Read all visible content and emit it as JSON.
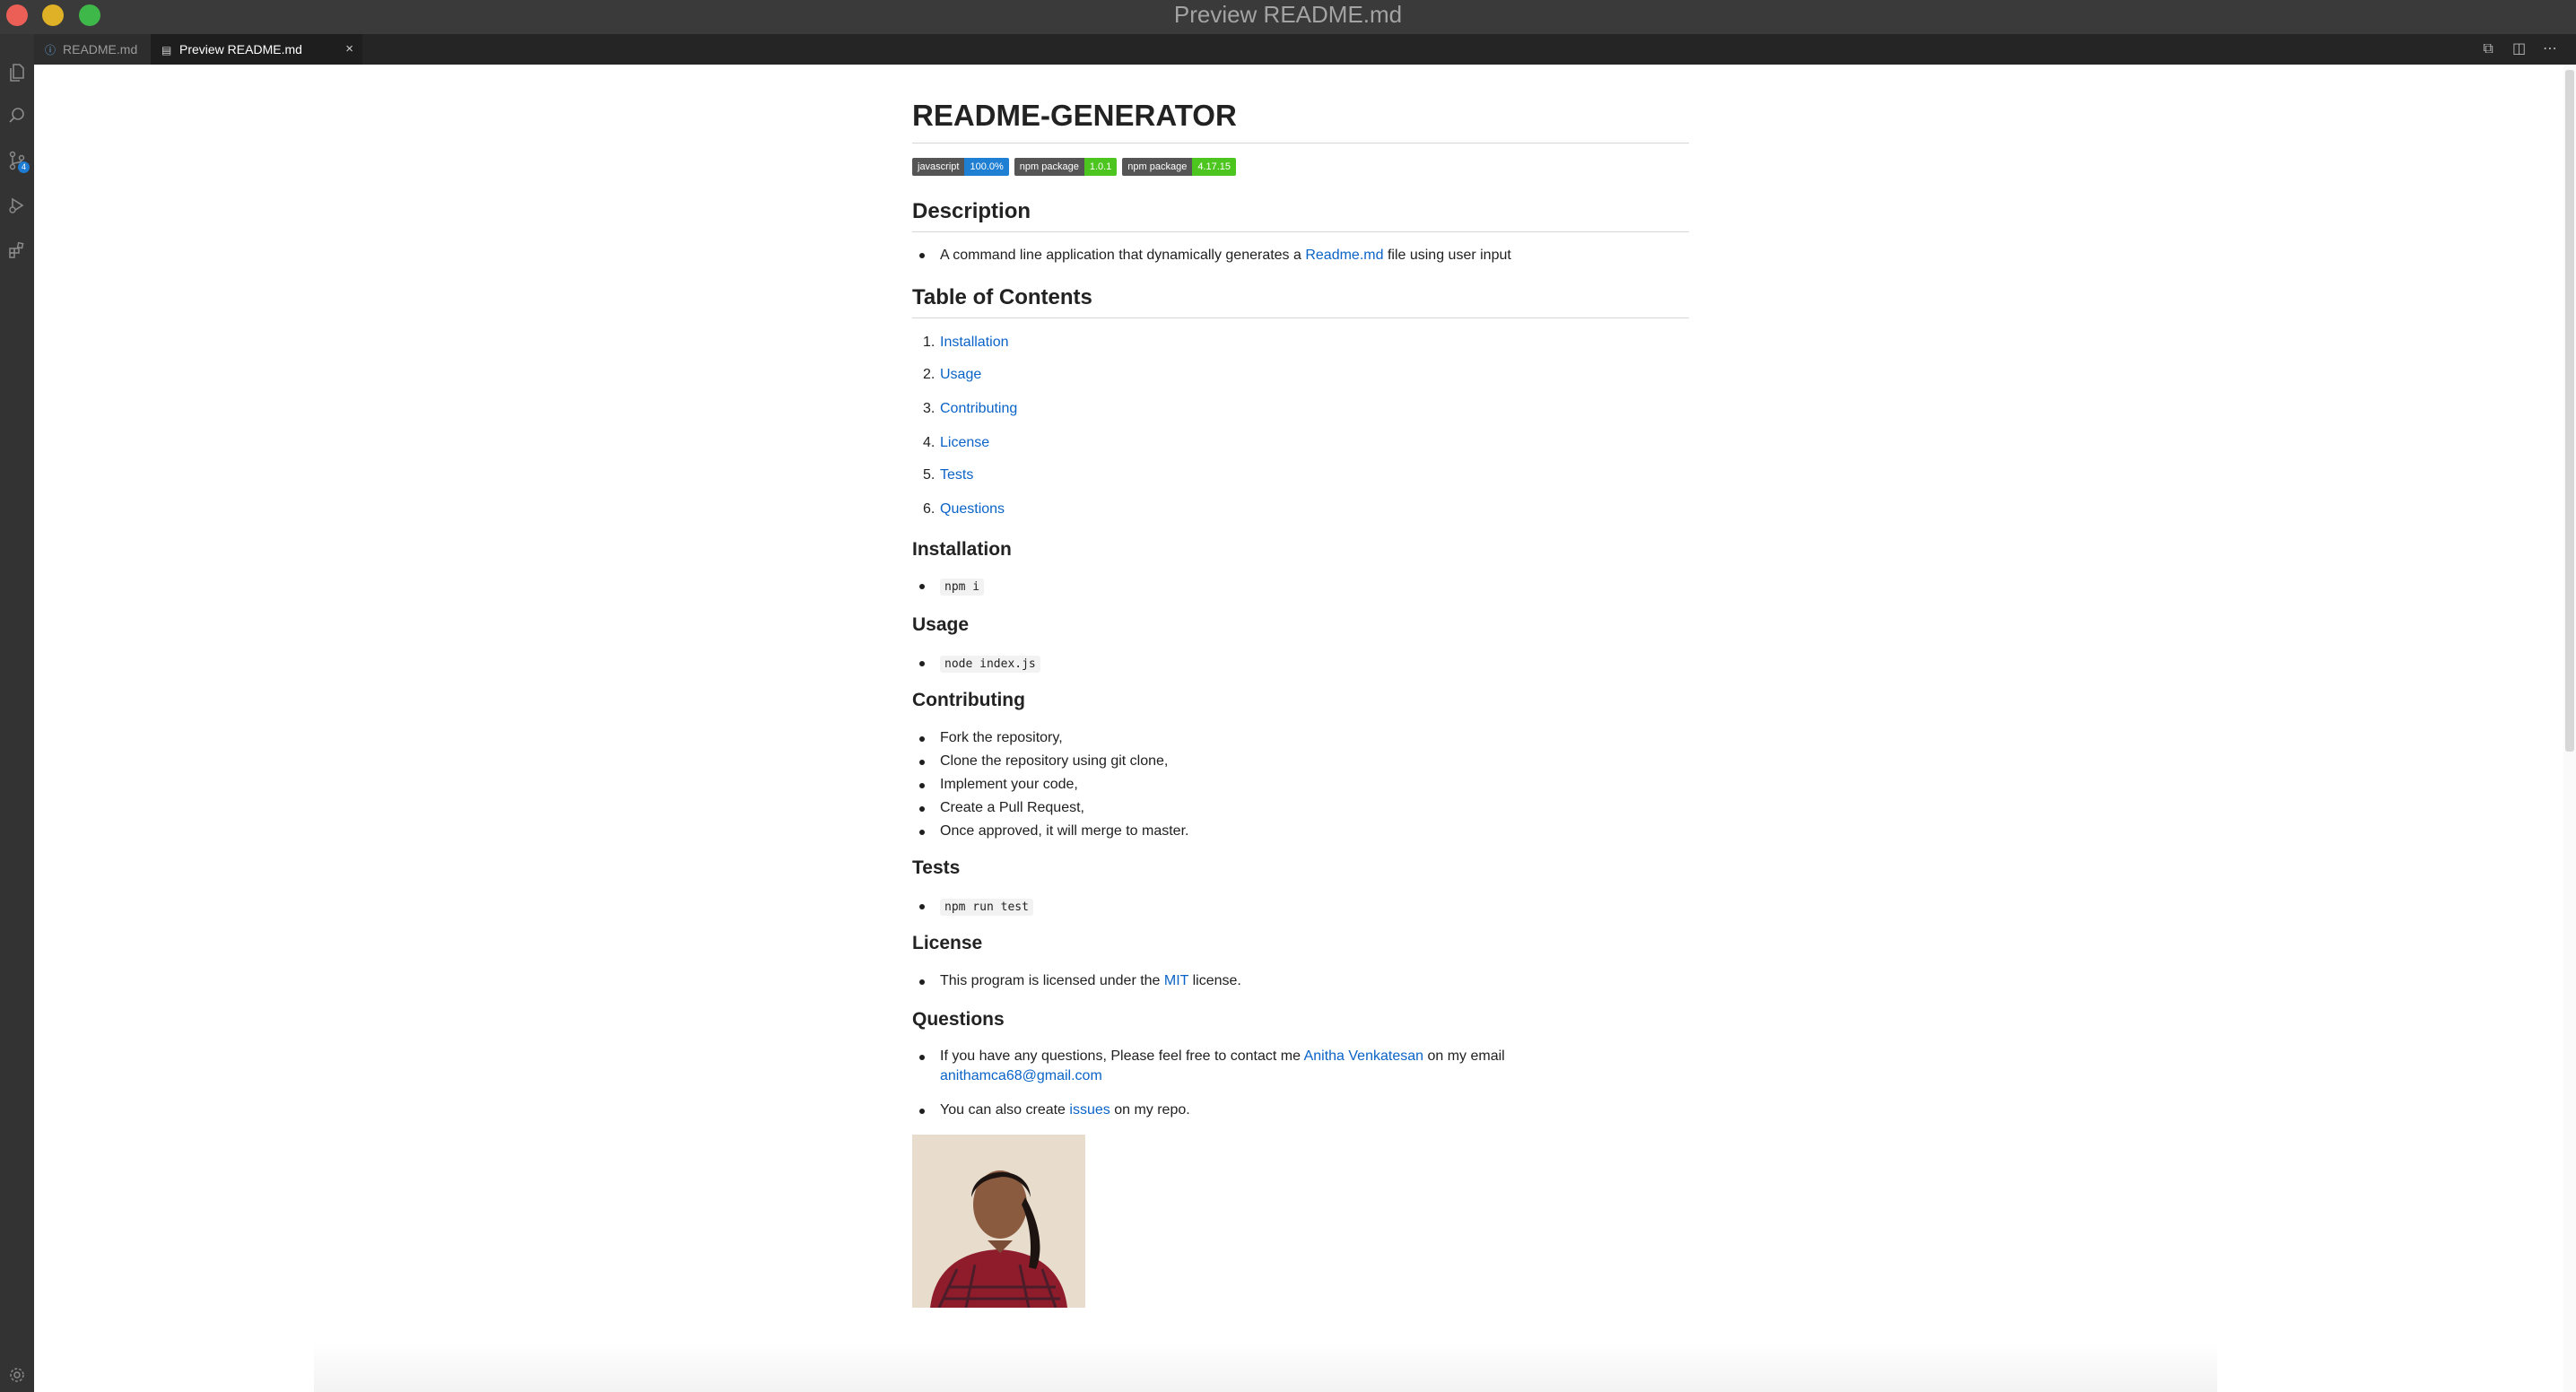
{
  "window": {
    "title": "Preview README.md"
  },
  "tabs": [
    {
      "label": "README.md",
      "icon": "info-icon"
    },
    {
      "label": "Preview README.md",
      "icon": "preview-icon",
      "close": "×"
    }
  ],
  "tab_actions": [
    "open-source-icon",
    "split-editor-icon",
    "more-actions-icon"
  ],
  "activity_bar": {
    "items": [
      "explorer-icon",
      "search-icon",
      "source-control-icon",
      "run-debug-icon",
      "extensions-icon"
    ],
    "source_control_badge": "4",
    "bottom": "settings-icon"
  },
  "doc": {
    "title": "README-GENERATOR",
    "badges": [
      {
        "key": "javascript",
        "value": "100.0%",
        "color": "#1e7fd3"
      },
      {
        "key": "npm package",
        "value": "1.0.1",
        "color": "#4cc61e"
      },
      {
        "key": "npm package",
        "value": "4.17.15",
        "color": "#4cc61e"
      }
    ],
    "description": {
      "heading": "Description",
      "text_before": "A command line application that dynamically generates a ",
      "link": "Readme.md",
      "text_after": " file using user input"
    },
    "toc": {
      "heading": "Table of Contents",
      "items": [
        "Installation",
        "Usage",
        "Contributing",
        "License",
        "Tests",
        "Questions"
      ]
    },
    "installation": {
      "heading": "Installation",
      "code": "npm i"
    },
    "usage": {
      "heading": "Usage",
      "code": "node index.js"
    },
    "contributing": {
      "heading": "Contributing",
      "items": [
        "Fork the repository,",
        "Clone the repository using git clone,",
        "Implement your code,",
        "Create a Pull Request,",
        "Once approved, it will merge to master."
      ]
    },
    "tests": {
      "heading": "Tests",
      "code": "npm run test"
    },
    "license": {
      "heading": "License",
      "text_before": "This program is licensed under the ",
      "link": "MIT",
      "text_after": " license."
    },
    "questions": {
      "heading": "Questions",
      "q1_before": "If you have any questions, Please feel free to contact me ",
      "q1_link": "Anitha Venkatesan",
      "q1_mid": " on my email",
      "email": "anithamca68@gmail.com",
      "q2_before": "You can also create ",
      "q2_link": "issues",
      "q2_after": " on my repo."
    }
  }
}
